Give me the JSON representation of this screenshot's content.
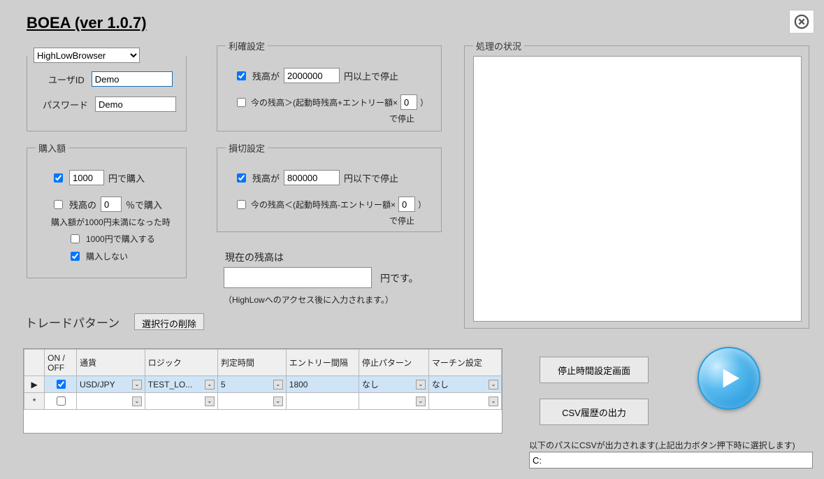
{
  "title": "BOEA (ver 1.0.7)",
  "broker_select": "HighLowBrowser",
  "login": {
    "user_label": "ユーザID",
    "user_value": "Demo",
    "pass_label": "パスワード",
    "pass_value": "Demo"
  },
  "amount": {
    "legend": "購入額",
    "fixed_checked": true,
    "fixed_value": "1000",
    "fixed_suffix": "円で購入",
    "pct_checked": false,
    "pct_prefix": "残高の",
    "pct_value": "0",
    "pct_suffix": "％で購入",
    "fallback_label": "購入額が1000円未満になった時",
    "fallback_opt1_checked": false,
    "fallback_opt1": "1000円で購入する",
    "fallback_opt2_checked": true,
    "fallback_opt2": "購入しない"
  },
  "profit": {
    "legend": "利確設定",
    "bal_checked": true,
    "bal_prefix": "残高が",
    "bal_value": "2000000",
    "bal_suffix": "円以上で停止",
    "calc_checked": false,
    "calc_prefix": "今の残高＞(起動時残高+エントリー額×",
    "calc_value": "0",
    "calc_suffix1": "）",
    "calc_suffix2": "で停止"
  },
  "loss": {
    "legend": "損切設定",
    "bal_checked": true,
    "bal_prefix": "残高が",
    "bal_value": "800000",
    "bal_suffix": "円以下で停止",
    "calc_checked": false,
    "calc_prefix": "今の残高＜(起動時残高-エントリー額×",
    "calc_value": "0",
    "calc_suffix1": "）",
    "calc_suffix2": "で停止"
  },
  "balance": {
    "label": "現在の残高は",
    "value": "",
    "suffix": "円です。",
    "note": "（HighLowへのアクセス後に入力されます。）"
  },
  "status": {
    "legend": "処理の状況"
  },
  "pattern": {
    "label": "トレードパターン",
    "delete_btn": "選択行の削除",
    "headers": {
      "onoff": "ON / OFF",
      "currency": "通貨",
      "logic": "ロジック",
      "time": "判定時間",
      "interval": "エントリー間隔",
      "stop": "停止パターン",
      "martin": "マーチン設定"
    },
    "rows": [
      {
        "marker": "▶",
        "on": true,
        "currency": "USD/JPY",
        "logic": "TEST_LO...",
        "time": "5",
        "interval": "1800",
        "stop": "なし",
        "martin": "なし"
      },
      {
        "marker": "*",
        "on": false,
        "currency": "",
        "logic": "",
        "time": "",
        "interval": "",
        "stop": "",
        "martin": ""
      }
    ]
  },
  "stop_time_btn": "停止時間設定画面",
  "csv_btn": "CSV履歴の出力",
  "csv_note": "以下のパスにCSVが出力されます(上記出力ボタン押下時に選択します)",
  "csv_path": "C:"
}
